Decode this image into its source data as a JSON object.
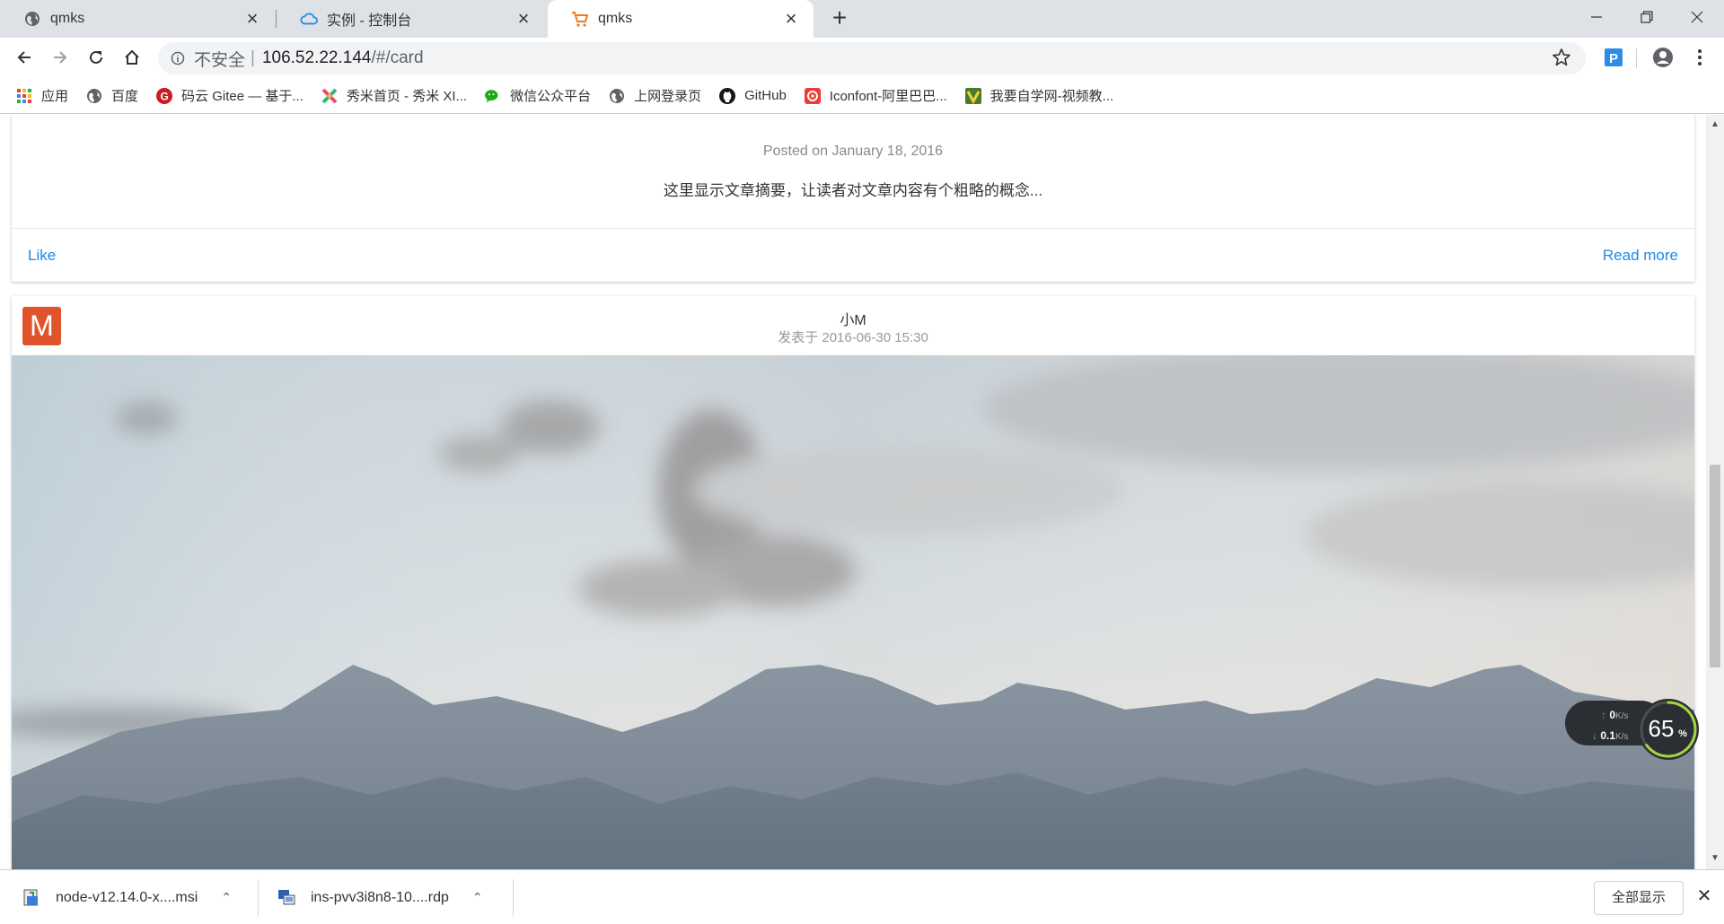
{
  "tabs": [
    {
      "title": "qmks",
      "icon": "globe-icon"
    },
    {
      "title": "实例 - 控制台",
      "icon": "cloud-icon"
    },
    {
      "title": "qmks",
      "icon": "cart-icon",
      "active": true
    }
  ],
  "toolbar": {
    "security_label": "不安全",
    "url_host": "106.52.22.144",
    "url_path": "/#/card"
  },
  "bookmarks": [
    {
      "label": "应用",
      "icon": "apps-grid-icon"
    },
    {
      "label": "百度",
      "icon": "globe-icon"
    },
    {
      "label": "码云 Gitee — 基于...",
      "icon": "gitee-icon"
    },
    {
      "label": "秀米首页 - 秀米 XI...",
      "icon": "xiumi-icon"
    },
    {
      "label": "微信公众平台",
      "icon": "wechat-icon"
    },
    {
      "label": "上网登录页",
      "icon": "globe-icon"
    },
    {
      "label": "GitHub",
      "icon": "github-icon"
    },
    {
      "label": "Iconfont-阿里巴巴...",
      "icon": "iconfont-icon"
    },
    {
      "label": "我要自学网-视频教...",
      "icon": "zixue-icon"
    }
  ],
  "card1": {
    "posted": "Posted on January 18, 2016",
    "summary": "这里显示文章摘要，让读者对文章内容有个粗略的概念...",
    "like_label": "Like",
    "read_more_label": "Read more"
  },
  "card2": {
    "avatar_letter": "M",
    "author": "小M",
    "date": "发表于 2016-06-30 15:30",
    "avatar_color": "#e0542c"
  },
  "speed_widget": {
    "upload": "0",
    "download": "0.1",
    "unit": "K/s",
    "percent": "65",
    "percent_unit": "%"
  },
  "downloads": {
    "items": [
      {
        "name": "node-v12.14.0-x....msi"
      },
      {
        "name": "ins-pvv3i8n8-10....rdp"
      }
    ],
    "show_all_label": "全部显示"
  },
  "colors": {
    "link": "#1e88e5",
    "tabstrip": "#dee1e6"
  }
}
